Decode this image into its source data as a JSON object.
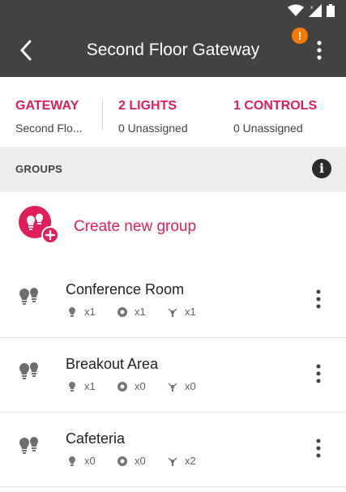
{
  "appbar": {
    "title": "Second Floor Gateway",
    "warning_glyph": "!",
    "accent_color": "#e01e5a",
    "bar_color": "#424242"
  },
  "summary": {
    "gateway": {
      "label": "GATEWAY",
      "sub": "Second Flo..."
    },
    "lights": {
      "label": "2 LIGHTS",
      "sub": "0 Unassigned"
    },
    "controls": {
      "label": "1 CONTROLS",
      "sub": "0 Unassigned"
    }
  },
  "groups_section": {
    "header": "GROUPS",
    "info_glyph": "i",
    "create_label": "Create new group"
  },
  "groups": [
    {
      "name": "Conference Room",
      "lights": "x1",
      "sensors": "x1",
      "controls": "x1"
    },
    {
      "name": "Breakout Area",
      "lights": "x1",
      "sensors": "x0",
      "controls": "x0"
    },
    {
      "name": "Cafeteria",
      "lights": "x0",
      "sensors": "x0",
      "controls": "x2"
    }
  ]
}
